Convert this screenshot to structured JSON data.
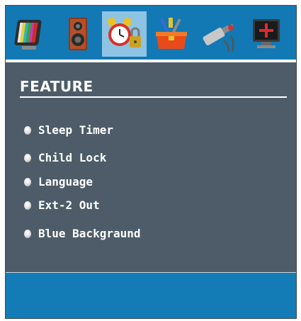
{
  "tabs": [
    {
      "name": "picture",
      "icon": "tv-color-bars-icon"
    },
    {
      "name": "sound",
      "icon": "speaker-icon"
    },
    {
      "name": "feature",
      "icon": "alarm-clock-lock-icon",
      "active": true
    },
    {
      "name": "install",
      "icon": "toolbox-icon"
    },
    {
      "name": "source",
      "icon": "cable-connector-icon"
    },
    {
      "name": "pc",
      "icon": "monitor-cross-icon"
    }
  ],
  "panel": {
    "title": "FEATURE",
    "items": [
      {
        "label": "Sleep Timer"
      },
      {
        "label": "Child Lock"
      },
      {
        "label": "Language"
      },
      {
        "label": "Ext-2 Out"
      },
      {
        "label": "Blue Backgraund"
      }
    ]
  },
  "colors": {
    "top_bar": "#1279b4",
    "active_tab": "#8fc3e3",
    "panel": "#4d5c68",
    "text": "#ffffff",
    "bottom_bar": "#137bb5"
  }
}
